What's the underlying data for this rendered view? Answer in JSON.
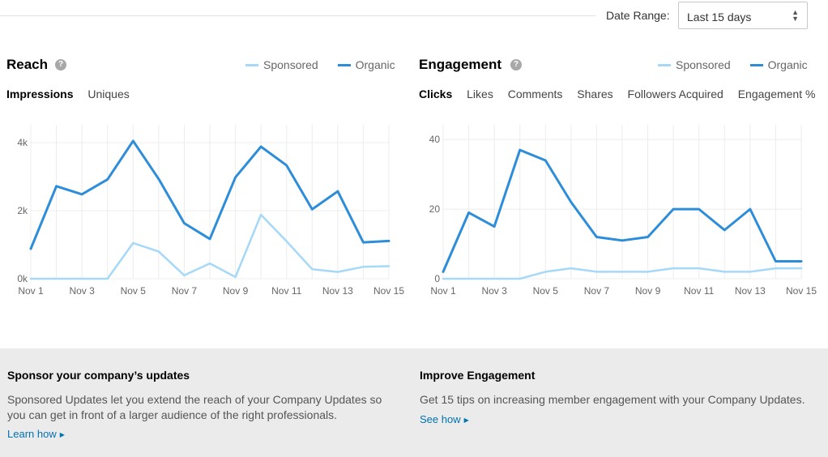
{
  "header": {
    "date_range_label": "Date Range:",
    "date_range_value": "Last 15 days"
  },
  "reach": {
    "title": "Reach",
    "help_icon": "?",
    "legend": {
      "sponsored": "Sponsored",
      "organic": "Organic"
    },
    "tabs": [
      {
        "label": "Impressions",
        "active": true
      },
      {
        "label": "Uniques",
        "active": false
      }
    ]
  },
  "engagement": {
    "title": "Engagement",
    "help_icon": "?",
    "legend": {
      "sponsored": "Sponsored",
      "organic": "Organic"
    },
    "tabs": [
      {
        "label": "Clicks",
        "active": true
      },
      {
        "label": "Likes",
        "active": false
      },
      {
        "label": "Comments",
        "active": false
      },
      {
        "label": "Shares",
        "active": false
      },
      {
        "label": "Followers Acquired",
        "active": false
      },
      {
        "label": "Engagement %",
        "active": false
      }
    ]
  },
  "colors": {
    "sponsored": "#a6d8f7",
    "organic": "#2d8dd9",
    "grid": "#ececec"
  },
  "chart_data": [
    {
      "type": "line",
      "x": [
        "Nov 1",
        "Nov 2",
        "Nov 3",
        "Nov 4",
        "Nov 5",
        "Nov 6",
        "Nov 7",
        "Nov 8",
        "Nov 9",
        "Nov 10",
        "Nov 11",
        "Nov 12",
        "Nov 13",
        "Nov 14",
        "Nov 15"
      ],
      "xticks": [
        "Nov 1",
        "Nov 3",
        "Nov 5",
        "Nov 7",
        "Nov 9",
        "Nov 11",
        "Nov 13",
        "Nov 15"
      ],
      "yticks": [
        0,
        2000,
        4000
      ],
      "ytick_labels": [
        "0k",
        "2k",
        "4k"
      ],
      "ylim": [
        0,
        4500
      ],
      "grid": true,
      "legend_position": "top-right",
      "series": [
        {
          "name": "Sponsored",
          "values": [
            0,
            0,
            0,
            0,
            1050,
            800,
            100,
            450,
            50,
            1880,
            1100,
            280,
            200,
            350,
            370
          ]
        },
        {
          "name": "Organic",
          "values": [
            880,
            2720,
            2480,
            2920,
            4050,
            2930,
            1630,
            1170,
            2980,
            3880,
            3330,
            2040,
            2570,
            1070,
            1110
          ]
        }
      ]
    },
    {
      "type": "line",
      "x": [
        "Nov 1",
        "Nov 2",
        "Nov 3",
        "Nov 4",
        "Nov 5",
        "Nov 6",
        "Nov 7",
        "Nov 8",
        "Nov 9",
        "Nov 10",
        "Nov 11",
        "Nov 12",
        "Nov 13",
        "Nov 14",
        "Nov 15"
      ],
      "xticks": [
        "Nov 1",
        "Nov 3",
        "Nov 5",
        "Nov 7",
        "Nov 9",
        "Nov 11",
        "Nov 13",
        "Nov 15"
      ],
      "yticks": [
        0,
        20,
        40
      ],
      "ytick_labels": [
        "0",
        "20",
        "40"
      ],
      "ylim": [
        0,
        44
      ],
      "grid": true,
      "legend_position": "top-right",
      "series": [
        {
          "name": "Sponsored",
          "values": [
            0,
            0,
            0,
            0,
            2,
            3,
            2,
            2,
            2,
            3,
            3,
            2,
            2,
            3,
            3
          ]
        },
        {
          "name": "Organic",
          "values": [
            2,
            19,
            15,
            37,
            34,
            22,
            12,
            11,
            12,
            20,
            20,
            14,
            20,
            5,
            5
          ]
        }
      ]
    }
  ],
  "footer": {
    "left": {
      "title": "Sponsor your company’s updates",
      "body_line1": "Sponsored Updates let you extend the reach of your Company Updates so",
      "body_line2": "you can get in front of a larger audience of the right professionals.",
      "link": "Learn how"
    },
    "right": {
      "title": "Improve Engagement",
      "body": "Get 15 tips on increasing member engagement with your Company Updates.",
      "link": "See how"
    }
  }
}
